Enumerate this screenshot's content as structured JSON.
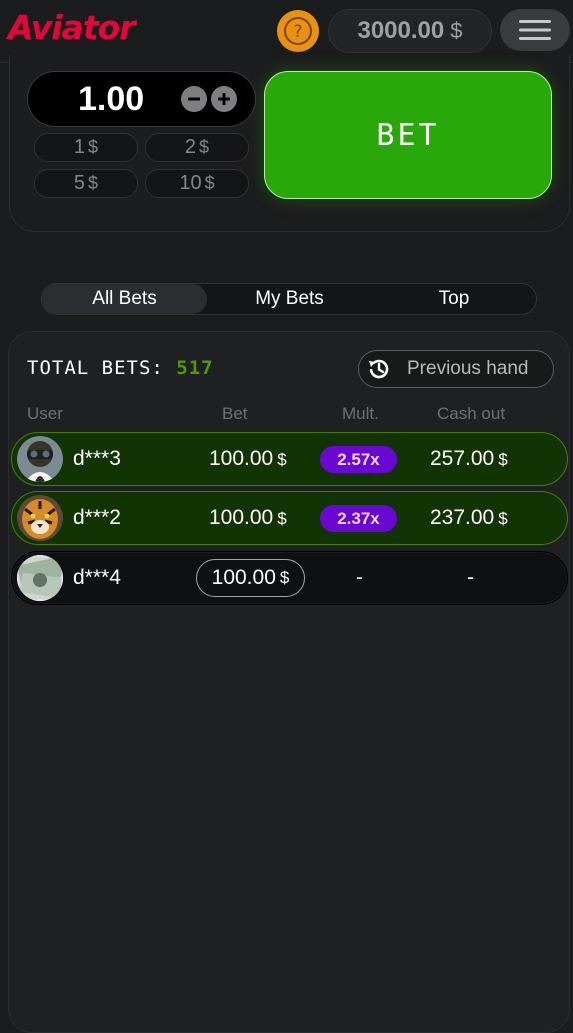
{
  "header": {
    "logo_text": "Aviator",
    "help_symbol": "?",
    "balance_value": "3000.00",
    "currency": "$",
    "menu_icon": "hamburger-menu-icon"
  },
  "bet_panel": {
    "amount": "1.00",
    "minus_symbol": "−",
    "plus_symbol": "+",
    "quick_amounts": [
      {
        "value": "1"
      },
      {
        "value": "2"
      },
      {
        "value": "5"
      },
      {
        "value": "10"
      }
    ],
    "bet_label": "BET"
  },
  "tabs": [
    {
      "label": "All Bets",
      "active": true
    },
    {
      "label": "My Bets",
      "active": false
    },
    {
      "label": "Top",
      "active": false
    }
  ],
  "bets": {
    "total_label": "TOTAL BETS:",
    "total_count": "517",
    "previous_hand_label": "Previous hand",
    "columns": {
      "user": "User",
      "bet": "Bet",
      "mult": "Mult.",
      "cash_out": "Cash out"
    },
    "rows": [
      {
        "user": "d***3",
        "bet": "100.00",
        "mult": "2.57x",
        "cash_out": "257.00",
        "avatar": "pilot-avatar",
        "won": true
      },
      {
        "user": "d***2",
        "bet": "100.00",
        "mult": "2.37x",
        "cash_out": "237.00",
        "avatar": "tiger-avatar",
        "won": true
      },
      {
        "user": "d***4",
        "bet": "100.00",
        "mult": "-",
        "cash_out": "-",
        "avatar": "money-avatar",
        "won": false
      }
    ]
  },
  "colors": {
    "brand_red": "#e50539",
    "bet_green": "#28a909",
    "win_row_bg": "#123405",
    "mult_purple": "#6b07d2",
    "total_green": "#4f9a06",
    "help_orange": "#e8920f"
  }
}
